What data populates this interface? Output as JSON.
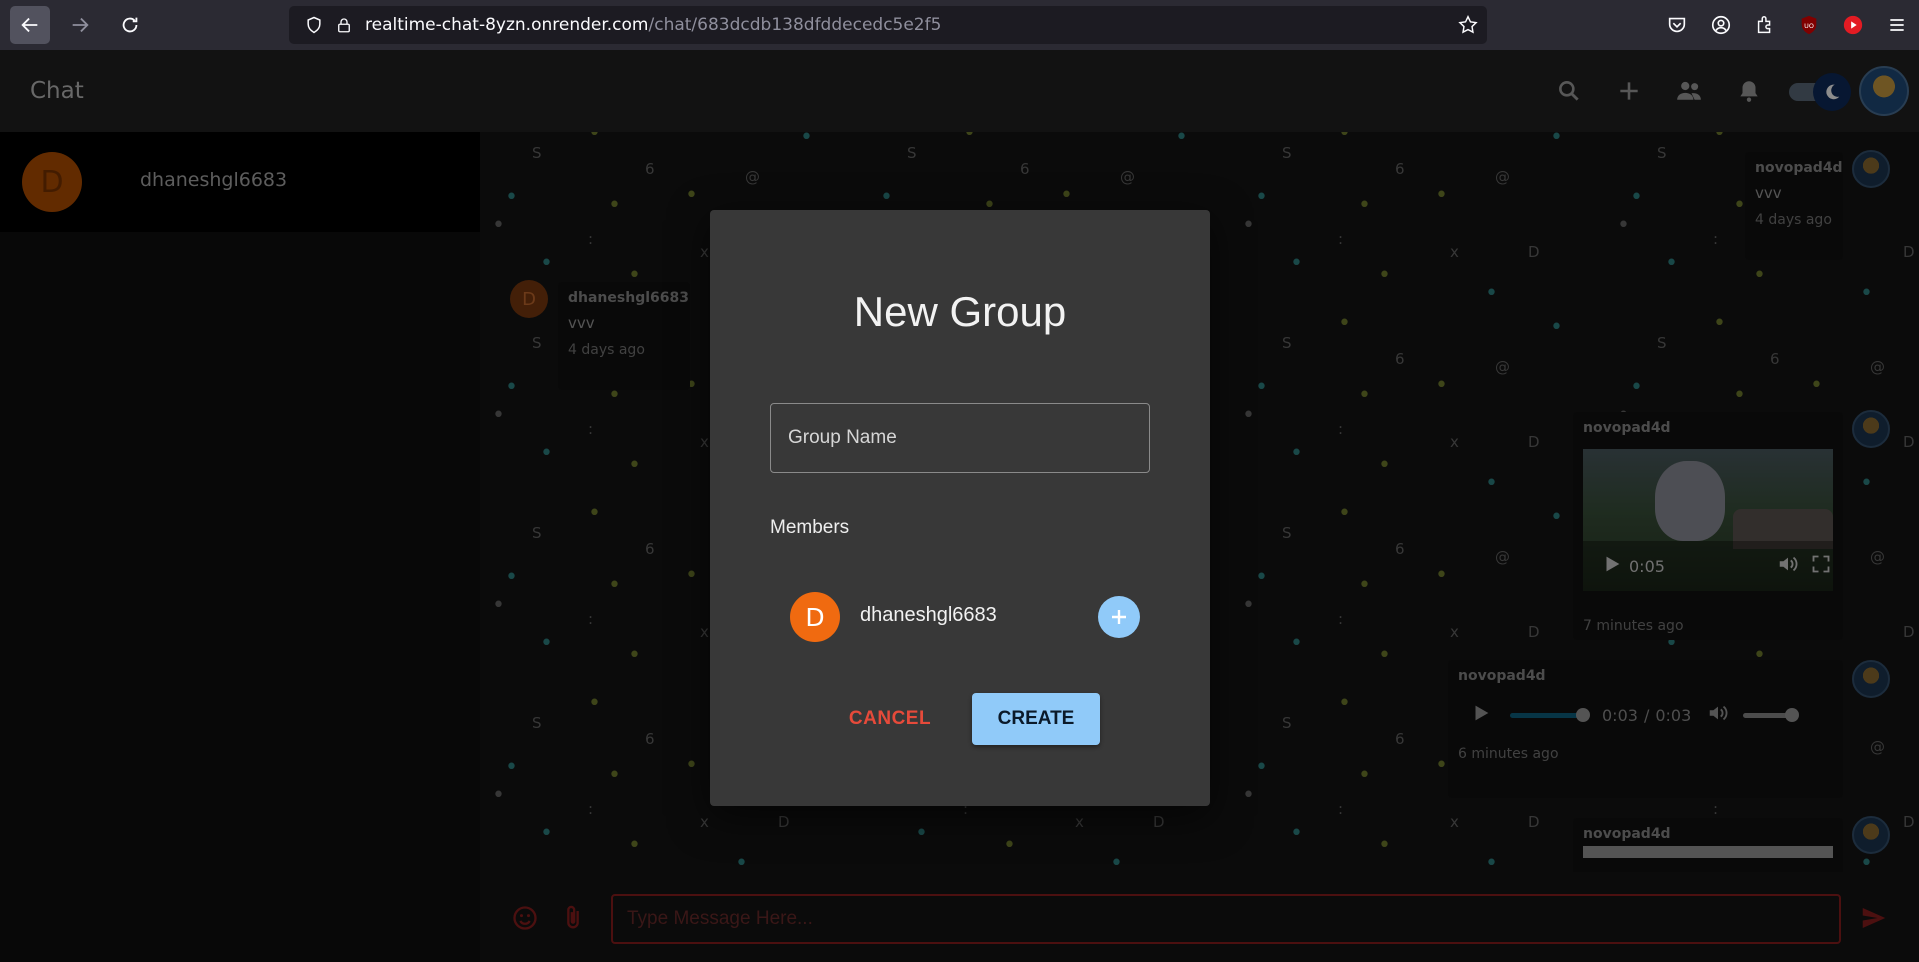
{
  "browser": {
    "url_host": "realtime-chat-8yzn.onrender.com",
    "url_path": "/chat/683dcdb138dfddecedc5e2f5",
    "icons": [
      "back-arrow-icon",
      "forward-arrow-icon",
      "reload-icon",
      "shield-icon",
      "lock-icon",
      "star-icon",
      "pocket-icon",
      "account-icon",
      "extensions-icon",
      "ublock-icon",
      "youtube-icon",
      "menu-icon"
    ]
  },
  "app": {
    "title": "Chat",
    "header_icons": [
      "search-icon",
      "add-icon",
      "group-icon",
      "bell-icon",
      "theme-toggle",
      "avatar"
    ]
  },
  "sidebar": {
    "contacts": [
      {
        "initial": "D",
        "name": "dhaneshgl6683"
      }
    ]
  },
  "messages": [
    {
      "sender": "novopad4d",
      "text": "vvv",
      "time": "4 days ago",
      "side": "right"
    },
    {
      "sender": "dhaneshgl6683",
      "text": "vvv",
      "time": "4 days ago",
      "side": "left",
      "initial": "D"
    },
    {
      "sender": "novopad4d",
      "type": "video",
      "video_time": "0:05",
      "time": "7 minutes ago",
      "side": "right"
    },
    {
      "sender": "novopad4d",
      "type": "audio",
      "current": "0:03",
      "separator": "/",
      "duration": "0:03",
      "time": "6 minutes ago",
      "side": "right"
    },
    {
      "sender": "novopad4d",
      "type": "partial",
      "side": "right"
    }
  ],
  "input": {
    "placeholder": "Type Message Here..."
  },
  "modal": {
    "title": "New Group",
    "group_name_placeholder": "Group Name",
    "members_label": "Members",
    "members": [
      {
        "initial": "D",
        "name": "dhaneshgl6683"
      }
    ],
    "cancel_label": "CANCEL",
    "create_label": "CREATE"
  },
  "colors": {
    "accent_blue": "#90caf9",
    "cancel_red": "#e64a3a",
    "avatar_orange": "#f06a10",
    "input_border": "#8b1e1e"
  }
}
